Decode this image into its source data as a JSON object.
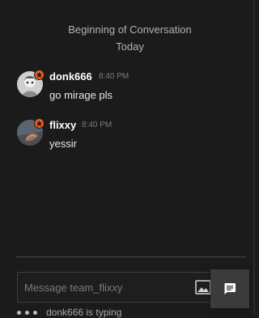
{
  "conversation": {
    "header_title": "Beginning of Conversation",
    "header_date": "Today"
  },
  "messages": [
    {
      "username": "donk666",
      "time": "8:40 PM",
      "text": "go mirage pls",
      "avatar": "donk666-avatar",
      "badge": "orange-star-badge-icon"
    },
    {
      "username": "flixxy",
      "time": "8:40 PM",
      "text": "yessir",
      "avatar": "flixxy-avatar",
      "badge": "orange-star-badge-icon"
    }
  ],
  "composer": {
    "placeholder": "Message team_flixxy",
    "value": "",
    "image_button_icon": "image-icon",
    "send_button_icon": "chat-bubble-icon"
  },
  "typing_indicator": {
    "text": "donk666 is typing"
  },
  "colors": {
    "background": "#1b1b1b",
    "badge": "#f05a1a",
    "username": "#ffffff",
    "timestamp": "#7b7b7b",
    "send_button": "#3b3b3b"
  }
}
